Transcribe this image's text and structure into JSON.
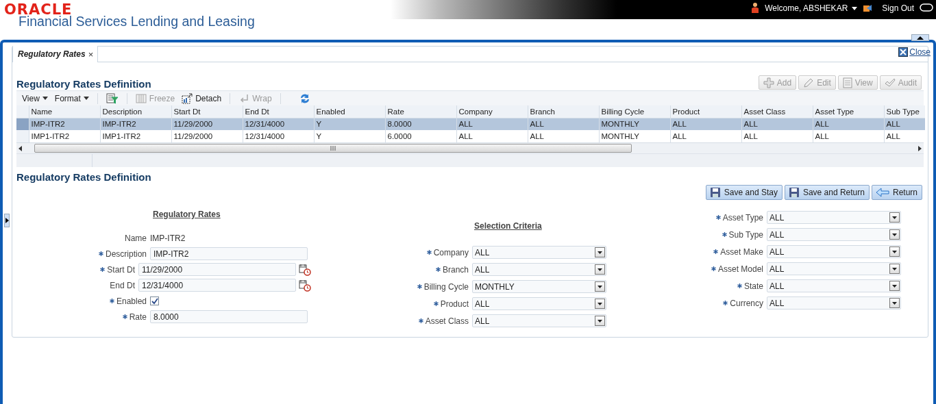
{
  "header": {
    "logo": "ORACLE",
    "app_title": "Financial Services Lending and Leasing",
    "user_menu": "Welcome, ABSHEKAR",
    "sign_out": "Sign Out"
  },
  "tabs": [
    {
      "label": "Regulatory Rates",
      "close": "×",
      "selected": true
    }
  ],
  "close_link": "Close",
  "list_section": {
    "title": "Regulatory Rates Definition",
    "actions": [
      {
        "label": "Add",
        "kind": "add",
        "disabled": true
      },
      {
        "label": "Edit",
        "kind": "edit",
        "disabled": true
      },
      {
        "label": "View",
        "kind": "view",
        "disabled": true
      },
      {
        "label": "Audit",
        "kind": "audit",
        "disabled": true
      }
    ],
    "toolbar": [
      {
        "kind": "menu",
        "label": "View"
      },
      {
        "kind": "menu",
        "label": "Format"
      },
      {
        "kind": "filter"
      },
      {
        "kind": "freeze",
        "label": "Freeze",
        "disabled": true
      },
      {
        "kind": "detach",
        "label": "Detach",
        "disabled": false
      },
      {
        "kind": "wrap",
        "label": "Wrap",
        "disabled": true
      },
      {
        "kind": "refresh"
      }
    ],
    "table": {
      "columns": [
        "Name",
        "Description",
        "Start Dt",
        "End Dt",
        "Enabled",
        "Rate",
        "Company",
        "Branch",
        "Billing Cycle",
        "Product",
        "Asset Class",
        "Asset Type",
        "Sub Type"
      ],
      "rows": [
        {
          "selected": true,
          "cells": [
            "IMP-ITR2",
            "IMP-ITR2",
            "11/29/2000",
            "12/31/4000",
            "Y",
            "8.0000",
            "ALL",
            "ALL",
            "MONTHLY",
            "ALL",
            "ALL",
            "ALL",
            "ALL"
          ]
        },
        {
          "selected": false,
          "cells": [
            "IMP1-ITR2",
            "IMP1-ITR2",
            "11/29/2000",
            "12/31/4000",
            "Y",
            "6.0000",
            "ALL",
            "ALL",
            "MONTHLY",
            "ALL",
            "ALL",
            "ALL",
            "ALL"
          ]
        }
      ]
    }
  },
  "detail_section": {
    "title": "Regulatory Rates Definition",
    "buttons": [
      {
        "label": "Save and Stay",
        "kind": "save"
      },
      {
        "label": "Save and Return",
        "kind": "save"
      },
      {
        "label": "Return",
        "kind": "back"
      }
    ],
    "regulatory_rates": {
      "heading": "Regulatory Rates",
      "fields": [
        {
          "kind": "readonly",
          "label": "Name",
          "required": false,
          "value": "IMP-ITR2"
        },
        {
          "kind": "text",
          "label": "Description",
          "required": true,
          "value": "IMP-ITR2"
        },
        {
          "kind": "date",
          "label": "Start Dt",
          "required": true,
          "value": "11/29/2000"
        },
        {
          "kind": "date",
          "label": "End Dt",
          "required": false,
          "value": "12/31/4000"
        },
        {
          "kind": "checkbox",
          "label": "Enabled",
          "required": true,
          "checked": true
        },
        {
          "kind": "text",
          "label": "Rate",
          "required": true,
          "value": "8.0000"
        }
      ]
    },
    "selection_criteria": {
      "heading": "Selection Criteria",
      "fields": [
        {
          "label": "Company",
          "required": true,
          "value": "ALL"
        },
        {
          "label": "Branch",
          "required": true,
          "value": "ALL"
        },
        {
          "label": "Billing Cycle",
          "required": true,
          "value": "MONTHLY"
        },
        {
          "label": "Product",
          "required": true,
          "value": "ALL"
        },
        {
          "label": "Asset Class",
          "required": true,
          "value": "ALL"
        }
      ]
    },
    "asset_criteria": {
      "fields": [
        {
          "label": "Asset Type",
          "required": true,
          "value": "ALL"
        },
        {
          "label": "Sub Type",
          "required": true,
          "value": "ALL"
        },
        {
          "label": "Asset Make",
          "required": true,
          "value": "ALL"
        },
        {
          "label": "Asset Model",
          "required": true,
          "value": "ALL"
        },
        {
          "label": "State",
          "required": true,
          "value": "ALL"
        },
        {
          "label": "Currency",
          "required": true,
          "value": "ALL"
        }
      ]
    }
  }
}
